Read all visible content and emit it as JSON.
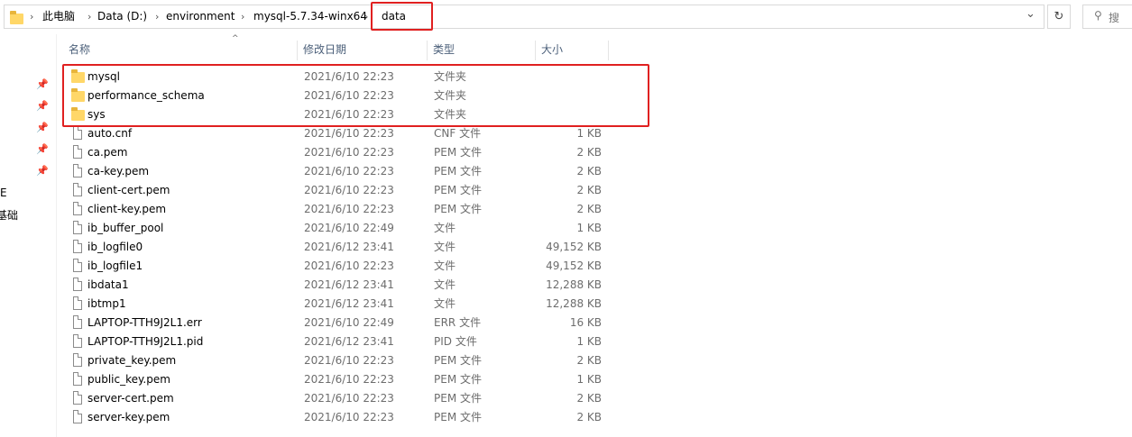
{
  "address": {
    "breadcrumbs": [
      "此电脑",
      "Data (D:)",
      "environment",
      "mysql-5.7.34-winx64",
      "data"
    ],
    "separator": "›",
    "dropdown_glyph": "⌄",
    "refresh_glyph": "↻",
    "search_glyph": "⚲",
    "search_placeholder": "搜"
  },
  "left_pane": {
    "pins": [
      "📌",
      "📌",
      "📌",
      "📌",
      "📌"
    ],
    "cut_labels": [
      "E",
      "基础"
    ]
  },
  "columns": {
    "name": "名称",
    "date": "修改日期",
    "type": "类型",
    "size": "大小",
    "sort_glyph": "^"
  },
  "files": [
    {
      "name": "mysql",
      "date": "2021/6/10 22:23",
      "type": "文件夹",
      "size": "",
      "kind": "folder"
    },
    {
      "name": "performance_schema",
      "date": "2021/6/10 22:23",
      "type": "文件夹",
      "size": "",
      "kind": "folder"
    },
    {
      "name": "sys",
      "date": "2021/6/10 22:23",
      "type": "文件夹",
      "size": "",
      "kind": "folder"
    },
    {
      "name": "auto.cnf",
      "date": "2021/6/10 22:23",
      "type": "CNF 文件",
      "size": "1 KB",
      "kind": "file"
    },
    {
      "name": "ca.pem",
      "date": "2021/6/10 22:23",
      "type": "PEM 文件",
      "size": "2 KB",
      "kind": "file"
    },
    {
      "name": "ca-key.pem",
      "date": "2021/6/10 22:23",
      "type": "PEM 文件",
      "size": "2 KB",
      "kind": "file"
    },
    {
      "name": "client-cert.pem",
      "date": "2021/6/10 22:23",
      "type": "PEM 文件",
      "size": "2 KB",
      "kind": "file"
    },
    {
      "name": "client-key.pem",
      "date": "2021/6/10 22:23",
      "type": "PEM 文件",
      "size": "2 KB",
      "kind": "file"
    },
    {
      "name": "ib_buffer_pool",
      "date": "2021/6/10 22:49",
      "type": "文件",
      "size": "1 KB",
      "kind": "file"
    },
    {
      "name": "ib_logfile0",
      "date": "2021/6/12 23:41",
      "type": "文件",
      "size": "49,152 KB",
      "kind": "file"
    },
    {
      "name": "ib_logfile1",
      "date": "2021/6/10 22:23",
      "type": "文件",
      "size": "49,152 KB",
      "kind": "file"
    },
    {
      "name": "ibdata1",
      "date": "2021/6/12 23:41",
      "type": "文件",
      "size": "12,288 KB",
      "kind": "file"
    },
    {
      "name": "ibtmp1",
      "date": "2021/6/12 23:41",
      "type": "文件",
      "size": "12,288 KB",
      "kind": "file"
    },
    {
      "name": "LAPTOP-TTH9J2L1.err",
      "date": "2021/6/10 22:49",
      "type": "ERR 文件",
      "size": "16 KB",
      "kind": "file"
    },
    {
      "name": "LAPTOP-TTH9J2L1.pid",
      "date": "2021/6/12 23:41",
      "type": "PID 文件",
      "size": "1 KB",
      "kind": "file"
    },
    {
      "name": "private_key.pem",
      "date": "2021/6/10 22:23",
      "type": "PEM 文件",
      "size": "2 KB",
      "kind": "file"
    },
    {
      "name": "public_key.pem",
      "date": "2021/6/10 22:23",
      "type": "PEM 文件",
      "size": "1 KB",
      "kind": "file"
    },
    {
      "name": "server-cert.pem",
      "date": "2021/6/10 22:23",
      "type": "PEM 文件",
      "size": "2 KB",
      "kind": "file"
    },
    {
      "name": "server-key.pem",
      "date": "2021/6/10 22:23",
      "type": "PEM 文件",
      "size": "2 KB",
      "kind": "file"
    }
  ],
  "colors": {
    "highlight": "#e02020",
    "folder": "#ffd768",
    "header_text": "#4c607a"
  }
}
